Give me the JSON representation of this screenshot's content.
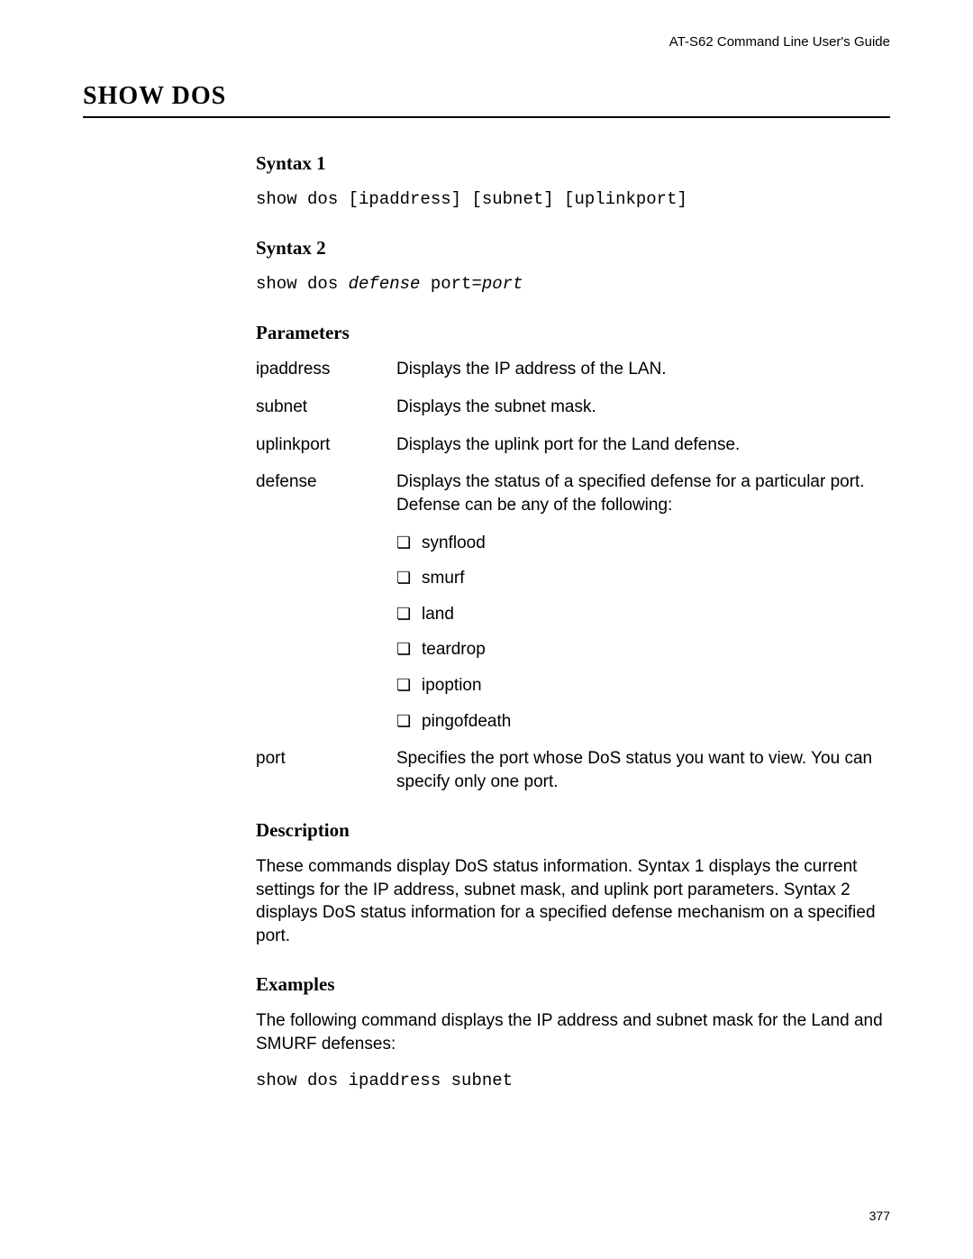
{
  "header": {
    "guide_title": "AT-S62 Command Line User's Guide"
  },
  "title": "SHOW DOS",
  "syntax1": {
    "heading": "Syntax 1",
    "line": "show dos [ipaddress] [subnet] [uplinkport]"
  },
  "syntax2": {
    "heading": "Syntax 2",
    "prefix": "show dos ",
    "ital1": "defense",
    "middle": " port=",
    "ital2": "port"
  },
  "parameters": {
    "heading": "Parameters",
    "items": [
      {
        "term": "ipaddress",
        "desc": "Displays the IP address of the LAN."
      },
      {
        "term": "subnet",
        "desc": "Displays the subnet mask."
      },
      {
        "term": "uplinkport",
        "desc": "Displays the uplink port for the Land defense."
      },
      {
        "term": "defense",
        "desc": "Displays the status of a specified defense for a particular port. Defense can be any of the following:"
      }
    ],
    "defense_options": [
      "synflood",
      "smurf",
      "land",
      "teardrop",
      "ipoption",
      "pingofdeath"
    ],
    "port": {
      "term": "port",
      "desc": "Specifies the port whose DoS status you want to view. You can specify only one port."
    }
  },
  "description": {
    "heading": "Description",
    "text": "These commands display DoS status information. Syntax 1 displays the current settings for the IP address, subnet mask, and uplink port parameters. Syntax 2 displays DoS status information for a specified defense mechanism on a specified port."
  },
  "examples": {
    "heading": "Examples",
    "intro": "The following command displays the IP address and subnet mask for the Land and SMURF defenses:",
    "cmd": "show dos ipaddress subnet"
  },
  "pagenum": "377",
  "bullet": "❏"
}
